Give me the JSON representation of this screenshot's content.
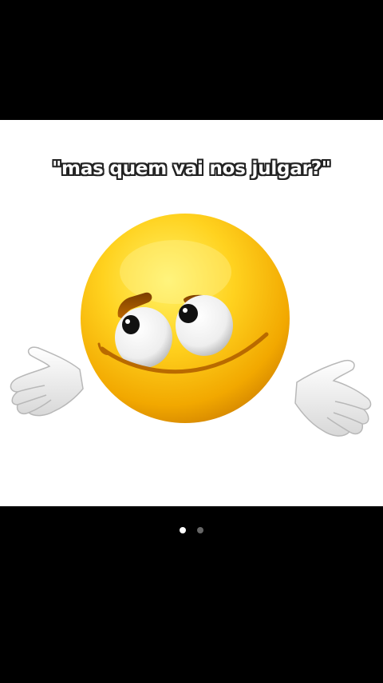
{
  "post": {
    "caption": "\"mas quem vai nos julgar?\""
  },
  "carousel": {
    "total_pages": 2,
    "current_page": 1
  },
  "colors": {
    "background": "#000000",
    "panel": "#ffffff",
    "emoji_yellow": "#f8c21a",
    "dot_active": "#ffffff",
    "dot_inactive": "#666666"
  },
  "icons": {
    "emoji": "shrugging-smiley-emoji-icon"
  }
}
